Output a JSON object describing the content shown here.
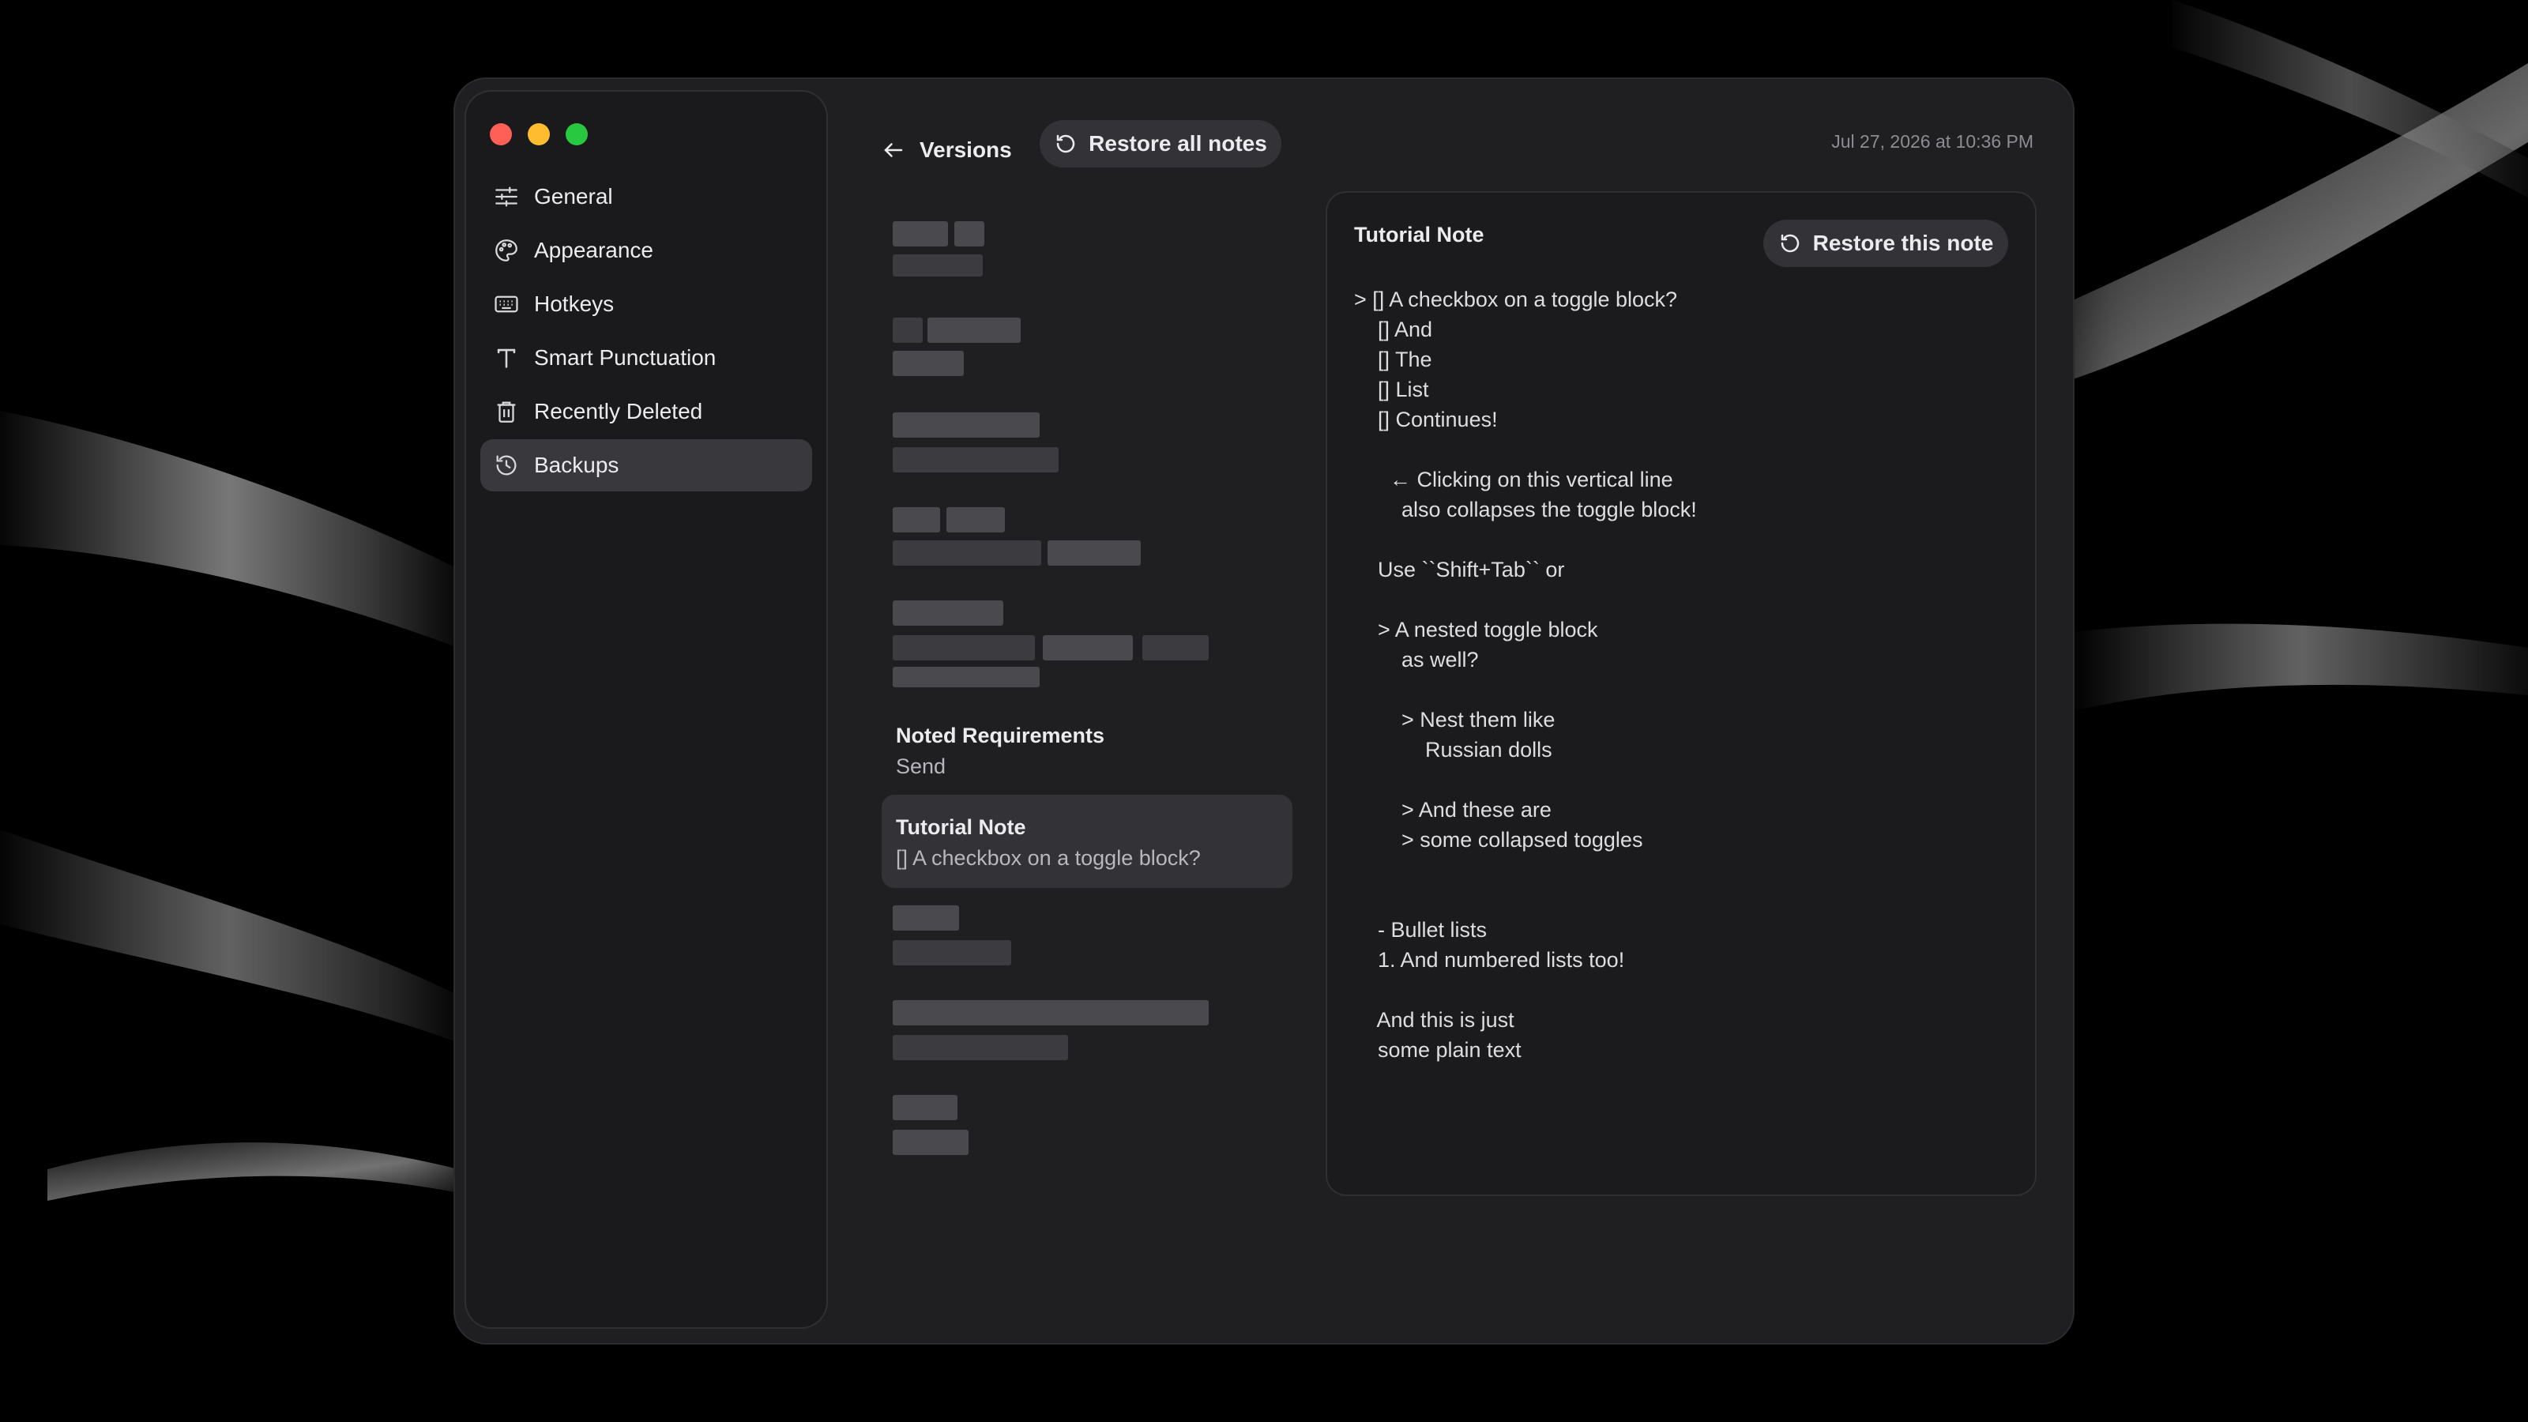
{
  "colors": {
    "accent_red": "#fe5f57",
    "accent_yellow": "#febc2e",
    "accent_green": "#28c840",
    "window_bg": "#1f1e20",
    "selected_bg": "#333236"
  },
  "sidebar": {
    "items": [
      {
        "label": "General",
        "icon": "sliders-icon"
      },
      {
        "label": "Appearance",
        "icon": "palette-icon"
      },
      {
        "label": "Hotkeys",
        "icon": "keyboard-icon"
      },
      {
        "label": "Smart Punctuation",
        "icon": "type-icon"
      },
      {
        "label": "Recently Deleted",
        "icon": "trash-icon"
      },
      {
        "label": "Backups",
        "icon": "history-icon",
        "active": true
      }
    ]
  },
  "header": {
    "back_label": "Versions",
    "restore_all_label": "Restore all notes",
    "timestamp": "Jul 27, 2026 at 10:36 PM"
  },
  "notes": {
    "visible": [
      {
        "title": "Noted Requirements",
        "preview": "Send"
      },
      {
        "title": "Tutorial Note",
        "preview": "[] A checkbox on a toggle block?",
        "selected": true
      }
    ]
  },
  "detail": {
    "title": "Tutorial Note",
    "restore_label": "Restore this note",
    "lines": [
      "> [] A checkbox on a toggle block?",
      "    [] And",
      "    [] The",
      "    [] List",
      "    [] Continues!",
      "",
      "      ← Clicking on this vertical line",
      "        also collapses the toggle block!",
      "",
      "    Use ``Shift+Tab`` or",
      "",
      "    > A nested toggle block",
      "        as well?",
      "",
      "        > Nest them like",
      "            Russian dolls",
      "",
      "        > And these are",
      "        > some collapsed toggles",
      "",
      "",
      "    - Bullet lists",
      "    1. And numbered lists too!",
      "",
      "    And this is just",
      "    some plain text"
    ]
  }
}
